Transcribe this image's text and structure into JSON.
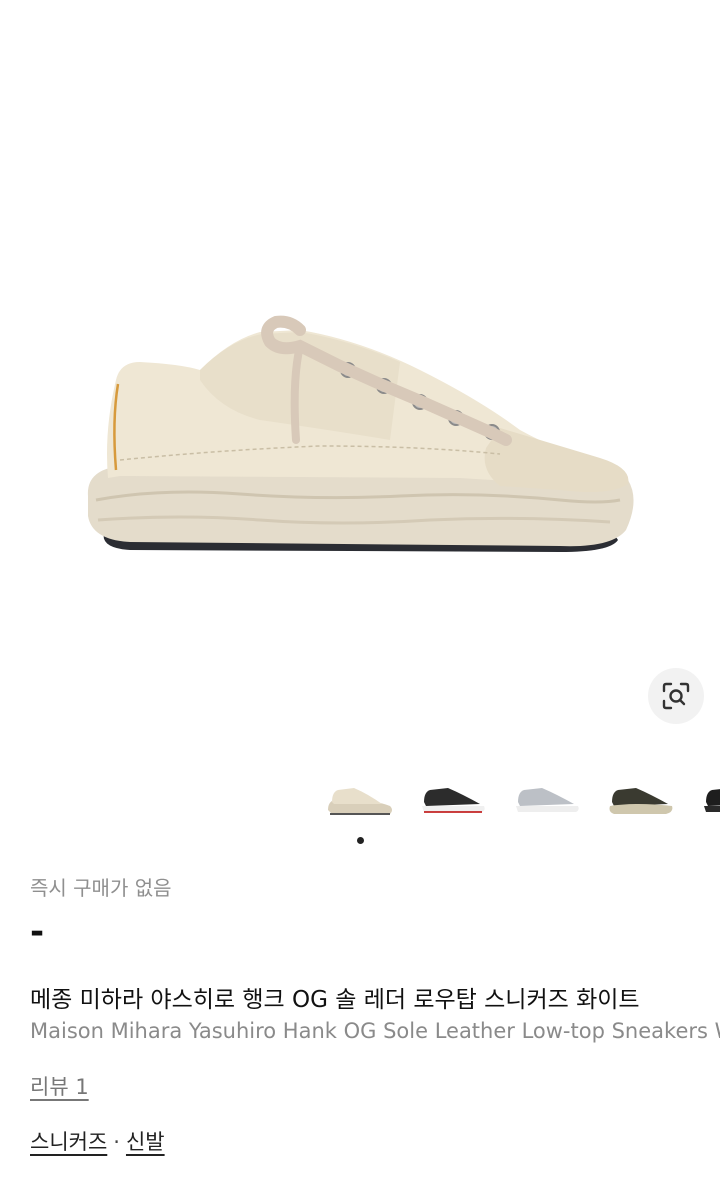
{
  "product": {
    "availability": "즉시 구매가 없음",
    "price": "-",
    "title_ko": "메종 미하라 야스히로 행크 OG 솔 레더 로우탑 스니커즈 화이트",
    "title_en": "Maison Mihara Yasuhiro Hank OG Sole Leather Low-top Sneakers White",
    "review_label": "리뷰 1",
    "categories": [
      "스니커즈",
      "신발"
    ],
    "category_separator": "·"
  },
  "gallery": {
    "thumbnails": [
      {
        "color": "cream"
      },
      {
        "color": "black"
      },
      {
        "color": "grey"
      },
      {
        "color": "olive-black"
      },
      {
        "color": "black"
      }
    ],
    "active_index": 0
  },
  "icons": {
    "lens": "lens-search-icon"
  }
}
